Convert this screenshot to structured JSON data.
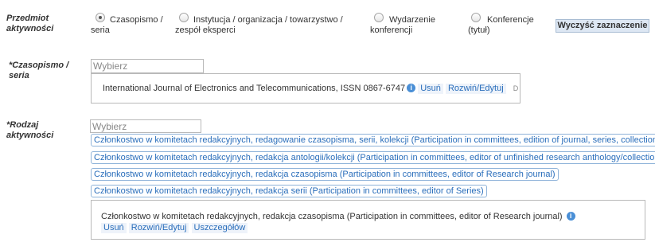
{
  "subject": {
    "label": "Przedmiot aktywności",
    "options": [
      {
        "label": "Czasopismo / seria",
        "checked": true
      },
      {
        "label": "Instytucja / organizacja / towarzystwo / zespół eksperci",
        "checked": false
      },
      {
        "label": "Wydarzenie konferencji",
        "checked": false
      },
      {
        "label": "Konferencje (tytuł)",
        "checked": false
      }
    ],
    "clear_button": "Wyczyść zaznaczenie"
  },
  "journal": {
    "label": "*Czasopismo / seria",
    "input_placeholder": "Wybierz",
    "selected_text": "International Journal of Electronics and Telecommunications, ISSN 0867-6747",
    "remove_link": "Usuń",
    "expand_link": "Rozwiń/Edytuj",
    "trailing": "D"
  },
  "activity": {
    "label": "*Rodzaj aktywności",
    "input_placeholder": "Wybierz",
    "suggestions": [
      "Członkostwo w komitetach redakcyjnych, redagowanie czasopisma, serii, kolekcji (Participation in committees, edition of journal, series, collection)",
      "Członkostwo w komitetach redakcyjnych, redakcja antologii/kolekcji (Participation in committees, editor of unfinished research anthology/collection)",
      "Członkostwo w komitetach redakcyjnych, redakcja czasopisma (Participation in committees, editor of Research journal)",
      "Członkostwo w komitetach redakcyjnych, redakcja serii (Participation in committees, editor of Series)"
    ],
    "selected_text": "Członkostwo w komitetach redakcyjnych, redakcja czasopisma (Participation in committees, editor of Research journal)",
    "remove_link": "Usuń",
    "expand_link": "Rozwiń/Edytuj",
    "details_link": "Uszczegółów"
  }
}
